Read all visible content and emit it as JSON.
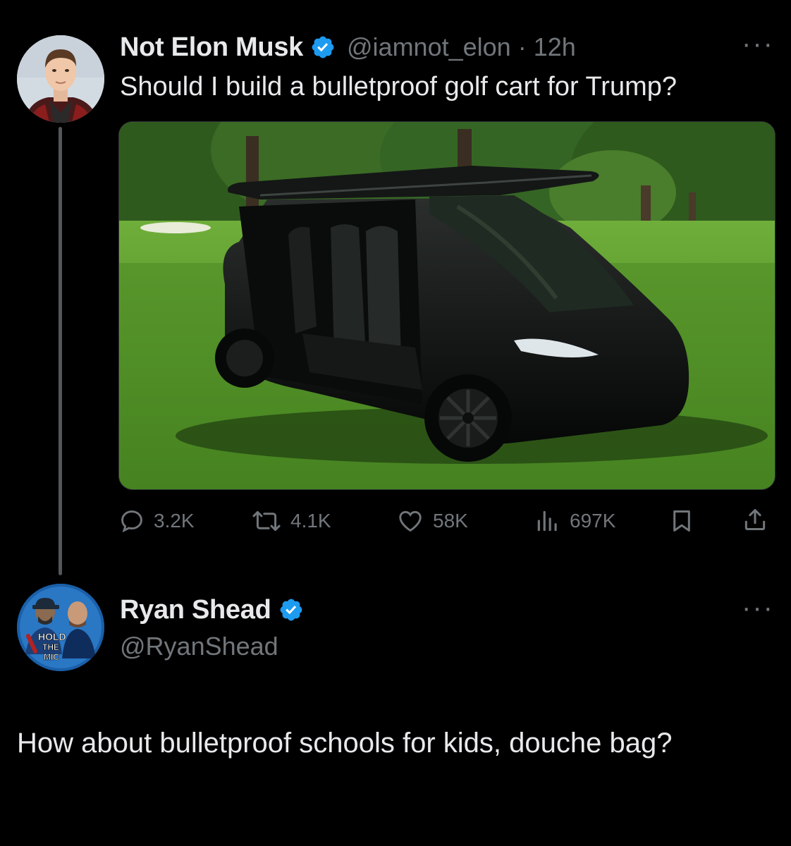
{
  "tweet": {
    "author_name": "Not Elon Musk",
    "handle": "@iamnot_elon",
    "separator": "·",
    "time": "12h",
    "more": "···",
    "text": "Should I build a bulletproof golf cart for Trump?",
    "stats": {
      "replies": "3.2K",
      "reposts": "4.1K",
      "likes": "58K",
      "views": "697K"
    }
  },
  "reply": {
    "author_name": "Ryan Shead",
    "handle": "@RyanShead",
    "more": "···",
    "avatar_logo_lines": [
      "HOLD",
      "THE",
      "MIC"
    ],
    "text": "How about bulletproof schools for kids, douche bag?"
  },
  "colors": {
    "background": "#000000",
    "text_primary": "#e7e9ea",
    "text_secondary": "#71767b",
    "verified": "#1d9bf0",
    "thread_line": "#52575c"
  }
}
